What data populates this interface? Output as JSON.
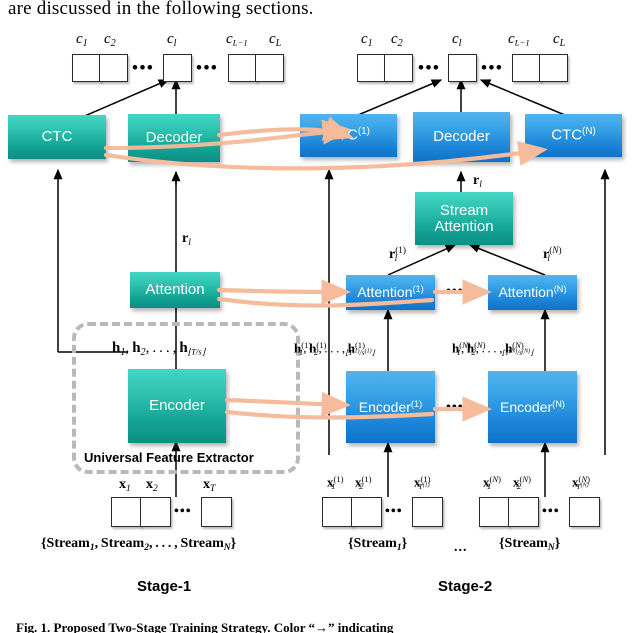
{
  "page": {
    "top_text": "are discussed in the following sections.",
    "caption": "Fig. 1.  Proposed Two-Stage Training Strategy. Color “→” indicating"
  },
  "colors": {
    "teal_node": "#12a394",
    "blue_node": "#1a82d6",
    "transfer_arrow": "#f6bb9b",
    "flow_arrow": "#000000",
    "dashed_group": "#b9b9b9",
    "cell_border": "#2b2b2b",
    "node_text": "#ffffff",
    "page_background": "#ffffff"
  },
  "stage1": {
    "label": "Stage-1",
    "output_tokens": [
      "c1",
      "c2",
      "cl",
      "cL-1",
      "cL"
    ],
    "output_token_display": [
      "c",
      "c",
      "c",
      "c",
      "c"
    ],
    "output_token_subs": [
      "1",
      "2",
      "l",
      "L−1",
      "L"
    ],
    "nodes": {
      "ctc": "CTC",
      "decoder": "Decoder",
      "attention": "Attention",
      "encoder": "Encoder"
    },
    "edge_labels": {
      "decoder_input": "r_l",
      "encoder_output": "h_1, h_2, . . . , h_[T/s]"
    },
    "group_label": "Universal Feature Extractor",
    "input_labels": [
      "x1",
      "x2",
      "xT"
    ],
    "input_label_subs": [
      "1",
      "2",
      "T"
    ],
    "stream_set": "{Stream1, Stream2, . . . , StreamN}",
    "ellipsis": "•••"
  },
  "stage2": {
    "label": "Stage-2",
    "output_tokens": [
      "c1",
      "c2",
      "cl",
      "cL-1",
      "cL"
    ],
    "nodes": {
      "ctc_1": "CTC",
      "ctc_1_sup": "(1)",
      "decoder": "Decoder",
      "ctc_n": "CTC",
      "ctc_n_sup": "(N)",
      "stream_attention_line1": "Stream",
      "stream_attention_line2": "Attention",
      "attention_1": "Attention",
      "attention_1_sup": "(1)",
      "attention_n": "Attention",
      "attention_n_sup": "(N)",
      "encoder_1": "Encoder",
      "encoder_1_sup": "(1)",
      "encoder_n": "Encoder",
      "encoder_n_sup": "(N)"
    },
    "edge_labels": {
      "decoder_input": "r_l",
      "stream_att_input_1": "r_l^(1)",
      "stream_att_input_n": "r_l^(N)",
      "encoder1_output": "h_1^(1), h_2^(1), . . . , h_[T^(1)/s^(1)]^(1)",
      "encodern_output": "h_1^(N), h_2^(N), . . . , h_[T^(N)/s^(N)]^(N)"
    },
    "stream_1_set": "{Stream1}",
    "stream_n_set": "{StreamN}",
    "between_streams": "...",
    "input_labels_1": [
      "x1(1)",
      "x2(1)",
      "xT(1)(1)"
    ],
    "input_labels_n": [
      "x1(N)",
      "x2(N)",
      "xT(N)(N)"
    ],
    "ellipsis": "•••"
  }
}
